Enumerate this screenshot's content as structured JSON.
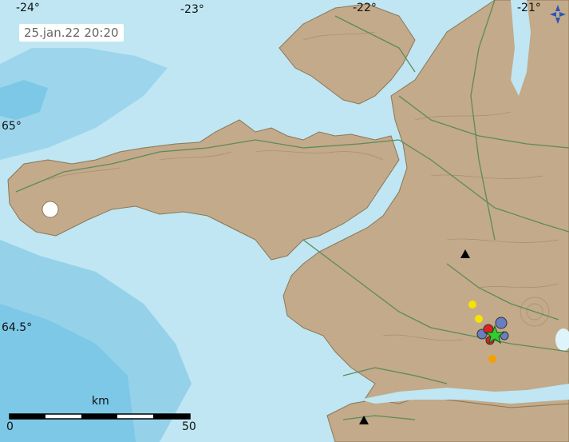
{
  "timestamp": "25.jan.22 20:20",
  "longitude_labels": [
    "-24°",
    "-23°",
    "-22°",
    "-21°"
  ],
  "latitude_labels": [
    "65°",
    "64.5°"
  ],
  "scale": {
    "unit": "km",
    "start": "0",
    "end": "50"
  },
  "icons": {
    "compass": "compass-arrows-icon",
    "volcano": "triangle-icon",
    "epicenter": "star-icon"
  },
  "colors": {
    "sea_shallow": "#bfe6f2",
    "sea_deep": "#6ec3e4",
    "land": "#c2aa8a",
    "roads": "#5d8a5a",
    "epicenter_star": "#33cc33",
    "quake_red": "#e02020",
    "quake_yellow": "#f5e400",
    "quake_orange": "#f5a000",
    "quake_blue": "#6a7fbf"
  }
}
